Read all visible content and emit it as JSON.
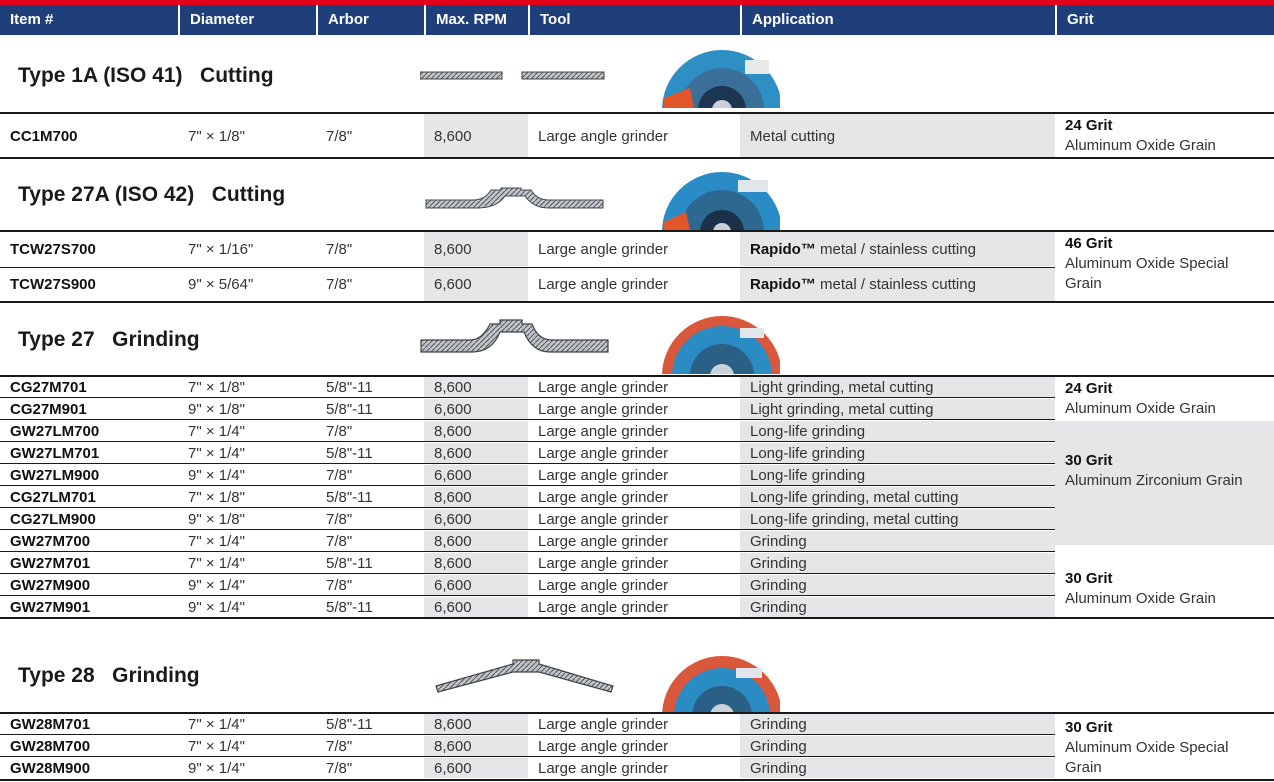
{
  "headers": [
    "Item #",
    "Diameter",
    "Arbor",
    "Max. RPM",
    "Tool",
    "Application",
    "Grit"
  ],
  "sections": [
    {
      "title": "Type 1A (ISO 41)   Cutting",
      "rows": [
        [
          "CC1M700",
          "7\" × 1/8\"",
          "7/8\"",
          "8,600",
          "Large angle grinder",
          "Metal cutting"
        ]
      ],
      "grits": [
        {
          "grit": "24 Grit",
          "desc": "Aluminum Oxide Grain"
        }
      ]
    },
    {
      "title": "Type 27A (ISO 42)   Cutting",
      "rows": [
        [
          "TCW27S700",
          "7\" × 1/16\"",
          "7/8\"",
          "8,600",
          "Large angle grinder",
          "metal / stainless cutting"
        ],
        [
          "TCW27S900",
          "9\" × 5/64\"",
          "7/8\"",
          "6,600",
          "Large angle grinder",
          "metal / stainless cutting"
        ]
      ],
      "app_prefix": "Rapido™",
      "grits": [
        {
          "grit": "46 Grit",
          "desc": "Aluminum Oxide Special Grain"
        }
      ]
    },
    {
      "title": "Type 27   Grinding",
      "rows": [
        [
          "CG27M701",
          "7\" × 1/8\"",
          "5/8\"-11",
          "8,600",
          "Large angle grinder",
          "Light grinding, metal cutting"
        ],
        [
          "CG27M901",
          "9\" × 1/8\"",
          "5/8\"-11",
          "6,600",
          "Large angle grinder",
          "Light grinding, metal cutting"
        ],
        [
          "GW27LM700",
          "7\" × 1/4\"",
          "7/8\"",
          "8,600",
          "Large angle grinder",
          "Long-life grinding"
        ],
        [
          "GW27LM701",
          "7\" × 1/4\"",
          "5/8\"-11",
          "8,600",
          "Large angle grinder",
          "Long-life grinding"
        ],
        [
          "GW27LM900",
          "9\" × 1/4\"",
          "7/8\"",
          "6,600",
          "Large angle grinder",
          "Long-life grinding"
        ],
        [
          "CG27LM701",
          "7\" × 1/8\"",
          "5/8\"-11",
          "8,600",
          "Large angle grinder",
          "Long-life grinding, metal cutting"
        ],
        [
          "CG27LM900",
          "9\" × 1/8\"",
          "7/8\"",
          "6,600",
          "Large angle grinder",
          "Long-life grinding, metal cutting"
        ],
        [
          "GW27M700",
          "7\" × 1/4\"",
          "7/8\"",
          "8,600",
          "Large angle grinder",
          "Grinding"
        ],
        [
          "GW27M701",
          "7\" × 1/4\"",
          "5/8\"-11",
          "8,600",
          "Large angle grinder",
          "Grinding"
        ],
        [
          "GW27M900",
          "9\" × 1/4\"",
          "7/8\"",
          "6,600",
          "Large angle grinder",
          "Grinding"
        ],
        [
          "GW27M901",
          "9\" × 1/4\"",
          "5/8\"-11",
          "6,600",
          "Large angle grinder",
          "Grinding"
        ]
      ],
      "grits": [
        {
          "grit": "24 Grit",
          "desc": "Aluminum Oxide Grain"
        },
        {
          "grit": "30 Grit",
          "desc": "Aluminum Zirconium Grain"
        },
        {
          "grit": "30 Grit",
          "desc": "Aluminum Oxide Grain"
        }
      ]
    },
    {
      "title": "Type 28   Grinding",
      "rows": [
        [
          "GW28M701",
          "7\" × 1/4\"",
          "5/8\"-11",
          "8,600",
          "Large angle grinder",
          "Grinding"
        ],
        [
          "GW28M700",
          "7\" × 1/4\"",
          "7/8\"",
          "8,600",
          "Large angle grinder",
          "Grinding"
        ],
        [
          "GW28M900",
          "9\" × 1/4\"",
          "7/8\"",
          "6,600",
          "Large angle grinder",
          "Grinding"
        ]
      ],
      "grits": [
        {
          "grit": "30 Grit",
          "desc": "Aluminum Oxide Special Grain"
        }
      ]
    }
  ],
  "colors": {
    "header_bg": "#1f3f7a",
    "accent_red": "#e2001a",
    "shade": "#e4e6e8"
  }
}
